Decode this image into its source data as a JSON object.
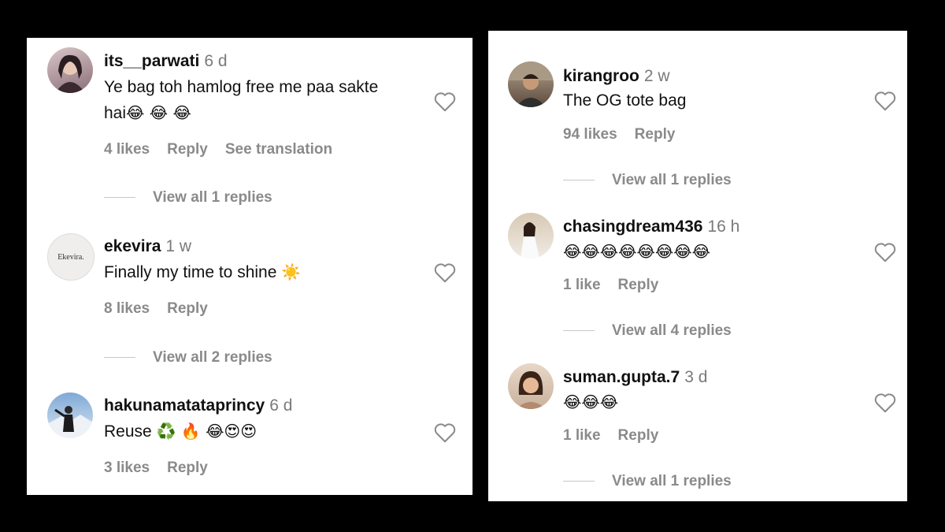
{
  "left_panel": {
    "comments": [
      {
        "username": "its__parwati",
        "time": "6 d",
        "text": "Ye bag toh hamlog free me paa sakte hai",
        "emojis": "😂 😂 😂",
        "likes": "4 likes",
        "reply": "Reply",
        "translate": "See translation",
        "replies": "View all 1 replies"
      },
      {
        "username": "ekevira",
        "time": "1 w",
        "text": "Finally my time to shine",
        "emojis": "☀️",
        "likes": "8 likes",
        "reply": "Reply",
        "replies": "View all 2 replies",
        "avatar_text": "Ekevira."
      },
      {
        "username": "hakunamatataprincy",
        "time": "6 d",
        "text": "Reuse",
        "emojis": "♻️ 🔥 😂😍😍",
        "likes": "3 likes",
        "reply": "Reply"
      }
    ]
  },
  "right_panel": {
    "comments": [
      {
        "username": "kirangroo",
        "time": "2 w",
        "text": "The OG tote bag",
        "likes": "94 likes",
        "reply": "Reply",
        "replies": "View all 1 replies"
      },
      {
        "username": "chasingdream436",
        "time": "16 h",
        "emojis": "😂😂😂😂😂😂😂😂",
        "likes": "1 like",
        "reply": "Reply",
        "replies": "View all 4 replies"
      },
      {
        "username": "suman.gupta.7",
        "time": "3 d",
        "emojis": "😂😂😂",
        "likes": "1 like",
        "reply": "Reply",
        "replies": "View all 1 replies"
      }
    ]
  },
  "colors": {
    "background": "#000000",
    "panel": "#ffffff",
    "username": "#111111",
    "muted": "#8a8a8a"
  },
  "icons": {
    "like": "heart-outline-icon"
  }
}
